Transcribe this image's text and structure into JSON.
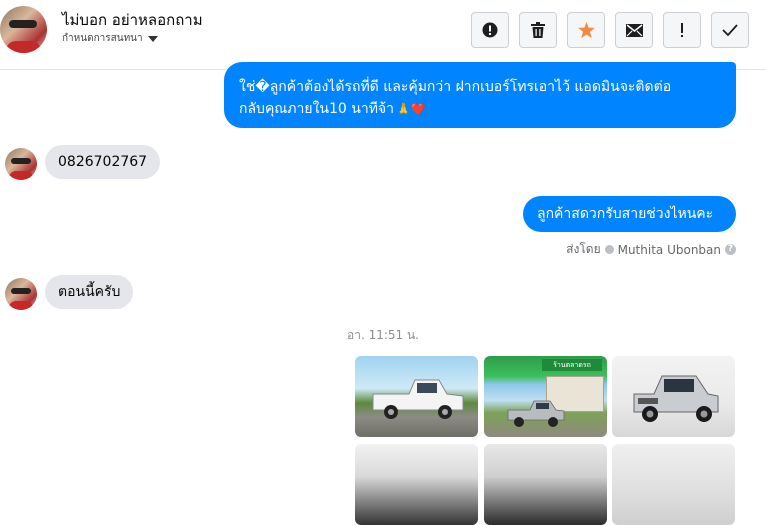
{
  "header": {
    "contact_name": "ไม่บอก อย่าหลอกถาม",
    "subtitle": "กำหนดการสนทนา",
    "buttons": [
      "report-icon",
      "trash-icon",
      "star-icon",
      "mail-icon",
      "exclamation-icon",
      "check-icon"
    ],
    "accent_star": "#f5893d"
  },
  "messages": {
    "m1_line1": "ใช่�ลูกค้าต้องได้รถที่ดี และคุ้มกว่า ฝากเบอร์โทรเอาไว้ แอดมินจะติดต่อ",
    "m1_line2": "กลับคุณภายใน10 นาทีจ้า",
    "m1_emoji": "🙏❤️",
    "m2": "0826702767",
    "m3": "ลูกค้าสดวกรับสายช่วงไหนคะ",
    "sent_by_label": "ส่งโดย",
    "sent_by_name": "Muthita Ubonban",
    "m4": "ตอนนี้ครับ",
    "timestamp": "อา. 11:51 น.",
    "photo_sign": "ร้านตลาดรถ"
  },
  "colors": {
    "outgoing": "#0084ff",
    "incoming": "#e4e6eb",
    "meta": "#65676b"
  }
}
